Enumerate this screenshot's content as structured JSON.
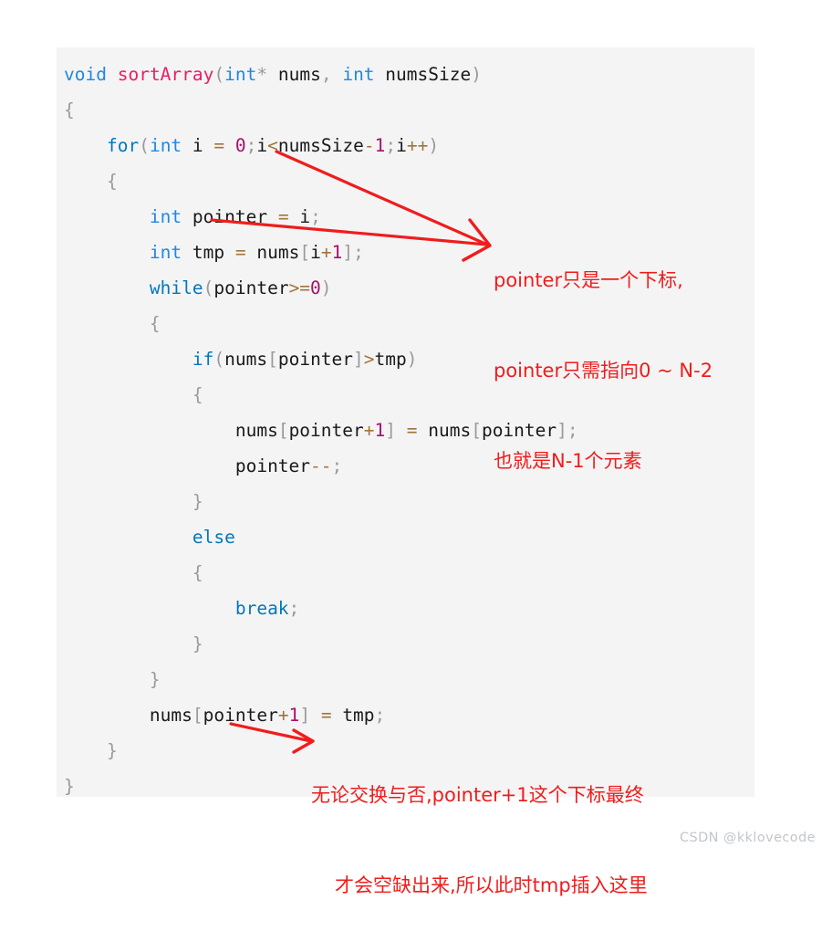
{
  "code_block": {
    "background": "#f4f4f4",
    "language": "c",
    "lines": [
      [
        {
          "t": "void",
          "c": "type"
        },
        {
          "t": " ",
          "c": "plain"
        },
        {
          "t": "sortArray",
          "c": "fn"
        },
        {
          "t": "(",
          "c": "punc"
        },
        {
          "t": "int",
          "c": "type"
        },
        {
          "t": "*",
          "c": "punc"
        },
        {
          "t": " nums",
          "c": "plain"
        },
        {
          "t": ",",
          "c": "punc"
        },
        {
          "t": " ",
          "c": "plain"
        },
        {
          "t": "int",
          "c": "type"
        },
        {
          "t": " numsSize",
          "c": "plain"
        },
        {
          "t": ")",
          "c": "punc"
        }
      ],
      [
        {
          "t": "{",
          "c": "brace"
        }
      ],
      [
        {
          "t": "    ",
          "c": "plain"
        },
        {
          "t": "for",
          "c": "kw"
        },
        {
          "t": "(",
          "c": "punc"
        },
        {
          "t": "int",
          "c": "type"
        },
        {
          "t": " i ",
          "c": "plain"
        },
        {
          "t": "=",
          "c": "op"
        },
        {
          "t": " ",
          "c": "plain"
        },
        {
          "t": "0",
          "c": "num"
        },
        {
          "t": ";",
          "c": "punc"
        },
        {
          "t": "i",
          "c": "plain"
        },
        {
          "t": "<",
          "c": "op"
        },
        {
          "t": "numsSize",
          "c": "plain"
        },
        {
          "t": "-",
          "c": "op"
        },
        {
          "t": "1",
          "c": "num"
        },
        {
          "t": ";",
          "c": "punc"
        },
        {
          "t": "i",
          "c": "plain"
        },
        {
          "t": "++",
          "c": "op"
        },
        {
          "t": ")",
          "c": "punc"
        }
      ],
      [
        {
          "t": "    ",
          "c": "plain"
        },
        {
          "t": "{",
          "c": "brace"
        }
      ],
      [
        {
          "t": "        ",
          "c": "plain"
        },
        {
          "t": "int",
          "c": "type"
        },
        {
          "t": " pointer ",
          "c": "plain"
        },
        {
          "t": "=",
          "c": "op"
        },
        {
          "t": " i",
          "c": "plain"
        },
        {
          "t": ";",
          "c": "punc"
        }
      ],
      [
        {
          "t": "        ",
          "c": "plain"
        },
        {
          "t": "int",
          "c": "type"
        },
        {
          "t": " tmp ",
          "c": "plain"
        },
        {
          "t": "=",
          "c": "op"
        },
        {
          "t": " nums",
          "c": "plain"
        },
        {
          "t": "[",
          "c": "punc"
        },
        {
          "t": "i",
          "c": "plain"
        },
        {
          "t": "+",
          "c": "op"
        },
        {
          "t": "1",
          "c": "num"
        },
        {
          "t": "]",
          "c": "punc"
        },
        {
          "t": ";",
          "c": "punc"
        }
      ],
      [
        {
          "t": "        ",
          "c": "plain"
        },
        {
          "t": "while",
          "c": "kw"
        },
        {
          "t": "(",
          "c": "punc"
        },
        {
          "t": "pointer",
          "c": "plain"
        },
        {
          "t": ">=",
          "c": "op"
        },
        {
          "t": "0",
          "c": "num"
        },
        {
          "t": ")",
          "c": "punc"
        }
      ],
      [
        {
          "t": "        ",
          "c": "plain"
        },
        {
          "t": "{",
          "c": "brace"
        }
      ],
      [
        {
          "t": "            ",
          "c": "plain"
        },
        {
          "t": "if",
          "c": "kw"
        },
        {
          "t": "(",
          "c": "punc"
        },
        {
          "t": "nums",
          "c": "plain"
        },
        {
          "t": "[",
          "c": "punc"
        },
        {
          "t": "pointer",
          "c": "plain"
        },
        {
          "t": "]",
          "c": "punc"
        },
        {
          "t": ">",
          "c": "op"
        },
        {
          "t": "tmp",
          "c": "plain"
        },
        {
          "t": ")",
          "c": "punc"
        }
      ],
      [
        {
          "t": "            ",
          "c": "plain"
        },
        {
          "t": "{",
          "c": "brace"
        }
      ],
      [
        {
          "t": "                ",
          "c": "plain"
        },
        {
          "t": "nums",
          "c": "plain"
        },
        {
          "t": "[",
          "c": "punc"
        },
        {
          "t": "pointer",
          "c": "plain"
        },
        {
          "t": "+",
          "c": "op"
        },
        {
          "t": "1",
          "c": "num"
        },
        {
          "t": "]",
          "c": "punc"
        },
        {
          "t": " ",
          "c": "plain"
        },
        {
          "t": "=",
          "c": "op"
        },
        {
          "t": " nums",
          "c": "plain"
        },
        {
          "t": "[",
          "c": "punc"
        },
        {
          "t": "pointer",
          "c": "plain"
        },
        {
          "t": "]",
          "c": "punc"
        },
        {
          "t": ";",
          "c": "punc"
        }
      ],
      [
        {
          "t": "                ",
          "c": "plain"
        },
        {
          "t": "pointer",
          "c": "plain"
        },
        {
          "t": "--",
          "c": "op"
        },
        {
          "t": ";",
          "c": "punc"
        }
      ],
      [
        {
          "t": "            ",
          "c": "plain"
        },
        {
          "t": "}",
          "c": "brace"
        }
      ],
      [
        {
          "t": "            ",
          "c": "plain"
        },
        {
          "t": "else",
          "c": "kw"
        }
      ],
      [
        {
          "t": "            ",
          "c": "plain"
        },
        {
          "t": "{",
          "c": "brace"
        }
      ],
      [
        {
          "t": "                ",
          "c": "plain"
        },
        {
          "t": "break",
          "c": "kw"
        },
        {
          "t": ";",
          "c": "punc"
        }
      ],
      [
        {
          "t": "            ",
          "c": "plain"
        },
        {
          "t": "}",
          "c": "brace"
        }
      ],
      [
        {
          "t": "        ",
          "c": "plain"
        },
        {
          "t": "}",
          "c": "brace"
        }
      ],
      [
        {
          "t": "        ",
          "c": "plain"
        },
        {
          "t": "nums",
          "c": "plain"
        },
        {
          "t": "[",
          "c": "punc"
        },
        {
          "t": "pointer",
          "c": "plain"
        },
        {
          "t": "+",
          "c": "op"
        },
        {
          "t": "1",
          "c": "num"
        },
        {
          "t": "]",
          "c": "punc"
        },
        {
          "t": " ",
          "c": "plain"
        },
        {
          "t": "=",
          "c": "op"
        },
        {
          "t": " tmp",
          "c": "plain"
        },
        {
          "t": ";",
          "c": "punc"
        }
      ],
      [
        {
          "t": "    ",
          "c": "plain"
        },
        {
          "t": "}",
          "c": "brace"
        }
      ],
      [
        {
          "t": "}",
          "c": "brace"
        }
      ]
    ]
  },
  "annotations": {
    "color": "#f01c1c",
    "top": {
      "line1": "pointer只是一个下标,",
      "line2": "pointer只需指向0 ~ N-2",
      "line3": "也就是N-1个元素"
    },
    "bottom": {
      "line1": "无论交换与否,pointer+1这个下标最终",
      "line2": "才会空缺出来,所以此时tmp插入这里"
    }
  },
  "watermark": {
    "text": "CSDN @kklovecode",
    "color": "#c2c6cc"
  }
}
